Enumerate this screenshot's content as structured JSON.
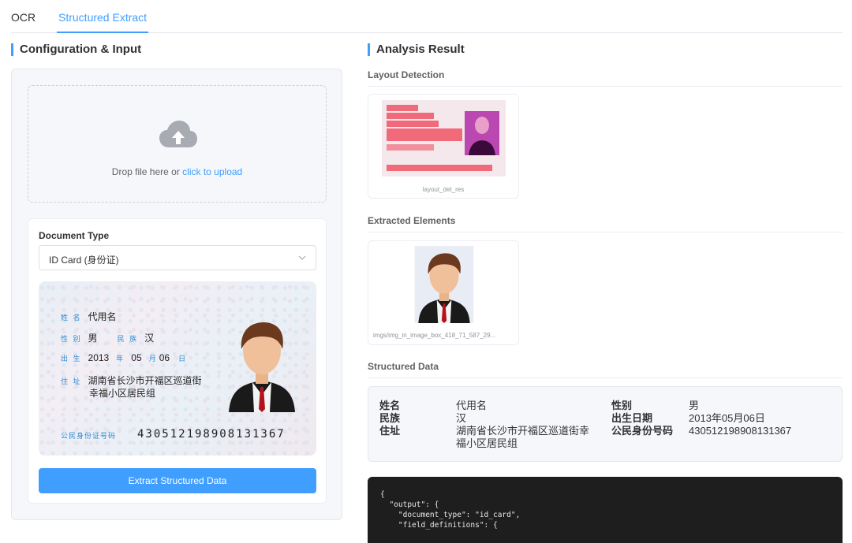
{
  "tabs": [
    {
      "label": "OCR"
    },
    {
      "label": "Structured Extract"
    }
  ],
  "left": {
    "title": "Configuration & Input",
    "upload": {
      "prefix": "Drop file here or",
      "link": "click to upload"
    },
    "doc_type_label": "Document Type",
    "doc_type_value": "ID Card (身份证)",
    "id_card": {
      "name_label": "姓 名",
      "name_value": "代用名",
      "gender_label": "性 别",
      "gender_value": "男",
      "ethnic_label": "民 族",
      "ethnic_value": "汉",
      "birth_label": "出 生",
      "birth_year": "2013",
      "year_label": "年",
      "birth_month": "05",
      "month_label": "月",
      "birth_day": "06",
      "day_label": "日",
      "address_label": "住 址",
      "address_line1": "湖南省长沙市开福区巡道街",
      "address_line2": "幸福小区居民组",
      "id_label": "公民身份证号码",
      "id_number": "430512198908131367"
    },
    "extract_button": "Extract Structured Data"
  },
  "right": {
    "title": "Analysis Result",
    "layout_detection": "Layout Detection",
    "layout_caption": "layout_det_res",
    "extracted_elements": "Extracted Elements",
    "element_caption": "imgs/img_in_image_box_418_71_587_29...",
    "structured_data": "Structured Data",
    "fields": [
      {
        "key": "姓名",
        "value": "代用名"
      },
      {
        "key": "民族",
        "value": "汉"
      },
      {
        "key": "住址",
        "value_line1": "湖南省长沙市开福区巡道街幸",
        "value_line2": "福小区居民组"
      },
      {
        "key": "性别",
        "value": "男"
      },
      {
        "key": "出生日期",
        "value": "2013年05月06日"
      },
      {
        "key": "公民身份号码",
        "value": "430512198908131367"
      }
    ],
    "code": "{\n  \"output\": {\n    \"document_type\": \"id_card\",\n    \"field_definitions\": {"
  },
  "colors": {
    "accent": "#409eff",
    "code_bg": "#1e1e1e",
    "panel_bg": "#f5f7fa"
  }
}
